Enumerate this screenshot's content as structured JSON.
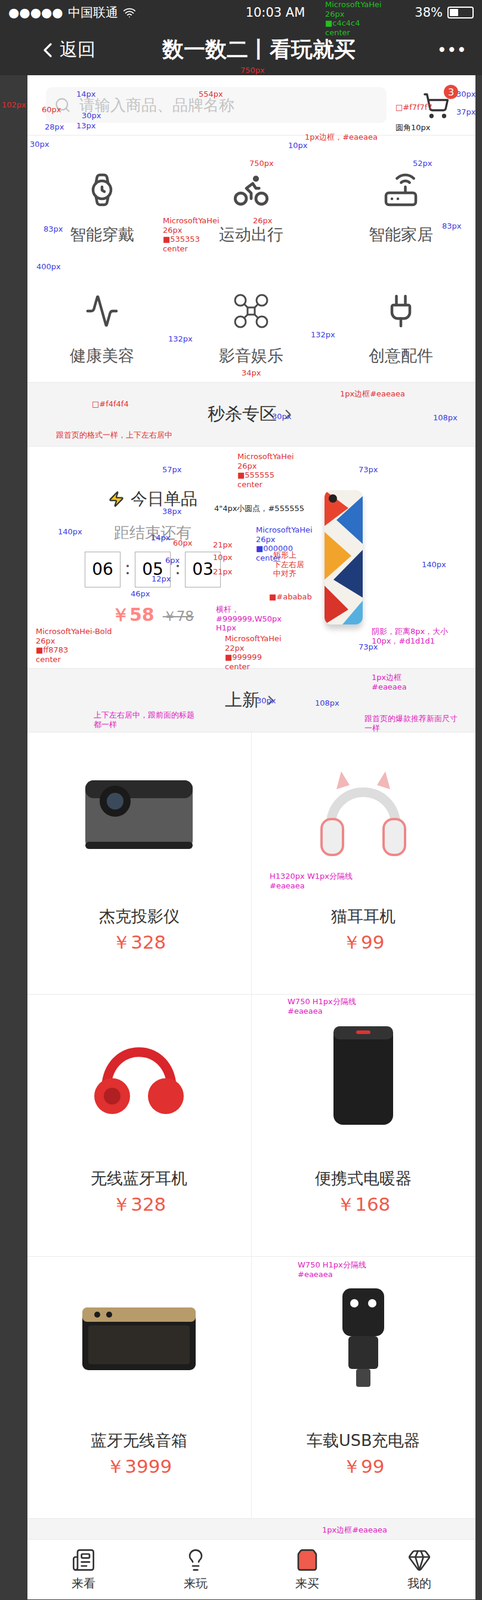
{
  "status_bar": {
    "signal": "●●●●●",
    "carrier": "中国联通",
    "time": "10:03 AM",
    "battery": "38%",
    "battery_level": 0.38
  },
  "nav": {
    "back": "返回",
    "title": "数一数二丨看玩就买",
    "more": "•••"
  },
  "search": {
    "placeholder": "请输入商品、品牌名称"
  },
  "cart": {
    "badge": "3"
  },
  "categories": [
    {
      "label": "智能穿戴"
    },
    {
      "label": "运动出行"
    },
    {
      "label": "智能家居"
    },
    {
      "label": "健康美容"
    },
    {
      "label": "影音娱乐"
    },
    {
      "label": "创意配件"
    }
  ],
  "flash_sale": {
    "title": "秒杀专区"
  },
  "today": {
    "title": "今日单品",
    "countdown_label": "距结束还有",
    "timer": [
      "06",
      "05",
      "03"
    ],
    "price": "￥58",
    "original_price": "￥78"
  },
  "new_arrivals": {
    "title": "上新",
    "products": [
      {
        "name": "杰克投影仪",
        "price": "￥328"
      },
      {
        "name": "猫耳耳机",
        "price": "￥99"
      },
      {
        "name": "无线蓝牙耳机",
        "price": "￥328"
      },
      {
        "name": "便携式电暖器",
        "price": "￥168"
      },
      {
        "name": "蓝牙无线音箱",
        "price": "￥3999"
      },
      {
        "name": "车载USB充电器",
        "price": "￥99"
      }
    ]
  },
  "tabs": [
    {
      "label": "来看",
      "selected": false
    },
    {
      "label": "来玩",
      "selected": false
    },
    {
      "label": "来买",
      "selected": true
    },
    {
      "label": "我的",
      "selected": false
    }
  ],
  "annotations": [
    {
      "text": "MicrosoftYaHei\n26px\n■c4c4c4\ncenter",
      "color": "#22c022"
    },
    {
      "text": "750px",
      "color": "#e03030"
    },
    {
      "text": "554px",
      "color": "#e03030"
    },
    {
      "text": "102px",
      "color": "#e03030"
    },
    {
      "text": "60px",
      "color": "#e03030"
    },
    {
      "text": "14px",
      "color": "#3a3ae0"
    },
    {
      "text": "30px",
      "color": "#3a3ae0"
    },
    {
      "text": "28px",
      "color": "#3a3ae0"
    },
    {
      "text": "13px",
      "color": "#3a3ae0"
    },
    {
      "text": "30px",
      "color": "#3a3ae0"
    },
    {
      "text": "□#f7f7f7",
      "color": "#e03030"
    },
    {
      "text": "30px",
      "color": "#3a3ae0"
    },
    {
      "text": "37px",
      "color": "#3a3ae0"
    },
    {
      "text": "圆角10px",
      "color": "#222222"
    },
    {
      "text": "1px边框，#eaeaea",
      "color": "#e03030"
    },
    {
      "text": "10px",
      "color": "#3a3ae0"
    },
    {
      "text": "750px",
      "color": "#e03030"
    },
    {
      "text": "52px",
      "color": "#3a3ae0"
    },
    {
      "text": "83px",
      "color": "#3a3ae0"
    },
    {
      "text": "83px",
      "color": "#3a3ae0"
    },
    {
      "text": "MicrosoftYaHei\n26px\n■535353\ncenter",
      "color": "#e03030"
    },
    {
      "text": "26px",
      "color": "#e03030"
    },
    {
      "text": "400px",
      "color": "#3a3ae0"
    },
    {
      "text": "132px",
      "color": "#3a3ae0"
    },
    {
      "text": "132px",
      "color": "#3a3ae0"
    },
    {
      "text": "34px",
      "color": "#e03030"
    },
    {
      "text": "1px边框#eaeaea",
      "color": "#e03030"
    },
    {
      "text": "□#f4f4f4",
      "color": "#e03030"
    },
    {
      "text": "跟首页的格式一样，上下左右居中",
      "color": "#e03030"
    },
    {
      "text": "30px",
      "color": "#3a3ae0"
    },
    {
      "text": "108px",
      "color": "#3a3ae0"
    },
    {
      "text": "57px",
      "color": "#3a3ae0"
    },
    {
      "text": "MicrosoftYaHei\n26px\n■555555\ncenter",
      "color": "#e03030"
    },
    {
      "text": "73px",
      "color": "#3a3ae0"
    },
    {
      "text": "38px",
      "color": "#3a3ae0"
    },
    {
      "text": "4\"4px小圆点，#555555",
      "color": "#222222"
    },
    {
      "text": "140px",
      "color": "#3a3ae0"
    },
    {
      "text": "140px",
      "color": "#3a3ae0"
    },
    {
      "text": "14px",
      "color": "#3a3ae0"
    },
    {
      "text": "MicrosoftYaHei\n26px\n■000000\ncenter",
      "color": "#3a3ae0"
    },
    {
      "text": "60px",
      "color": "#e03030"
    },
    {
      "text": "21px",
      "color": "#e03030"
    },
    {
      "text": "10px",
      "color": "#e03030"
    },
    {
      "text": "21px",
      "color": "#e03030"
    },
    {
      "text": "矩形上\n下左右居\n中对齐",
      "color": "#e03030"
    },
    {
      "text": "6px",
      "color": "#3a3ae0"
    },
    {
      "text": "12px",
      "color": "#3a3ae0"
    },
    {
      "text": "■#ababab",
      "color": "#e03030"
    },
    {
      "text": "46px",
      "color": "#3a3ae0"
    },
    {
      "text": "横杆，\n#999999,W50px\nH1px",
      "color": "#e020c0"
    },
    {
      "text": "MicrosoftYaHei-Bold\n26px\n■ff8783\ncenter",
      "color": "#e03030"
    },
    {
      "text": "MicrosoftYaHei\n22px\n■999999\ncenter",
      "color": "#e03030"
    },
    {
      "text": "阴影，距离8px，大小\n10px，#d1d1d1",
      "color": "#e020c0"
    },
    {
      "text": "73px",
      "color": "#3a3ae0"
    },
    {
      "text": "1px边框\n#eaeaea",
      "color": "#e020c0"
    },
    {
      "text": "108px",
      "color": "#3a3ae0"
    },
    {
      "text": "30px",
      "color": "#3a3ae0"
    },
    {
      "text": "上下左右居中，跟前面的标题\n都一样",
      "color": "#e020c0"
    },
    {
      "text": "跟首页的爆款推荐新面尺寸\n一样",
      "color": "#e020c0"
    },
    {
      "text": "H1320px W1px分隔线\n#eaeaea",
      "color": "#e020c0"
    },
    {
      "text": "W750 H1px分隔线\n#eaeaea",
      "color": "#e020c0"
    },
    {
      "text": "W750 H1px分隔线\n#eaeaea",
      "color": "#e020c0"
    },
    {
      "text": "1px边框#eaeaea",
      "color": "#e020c0"
    }
  ]
}
